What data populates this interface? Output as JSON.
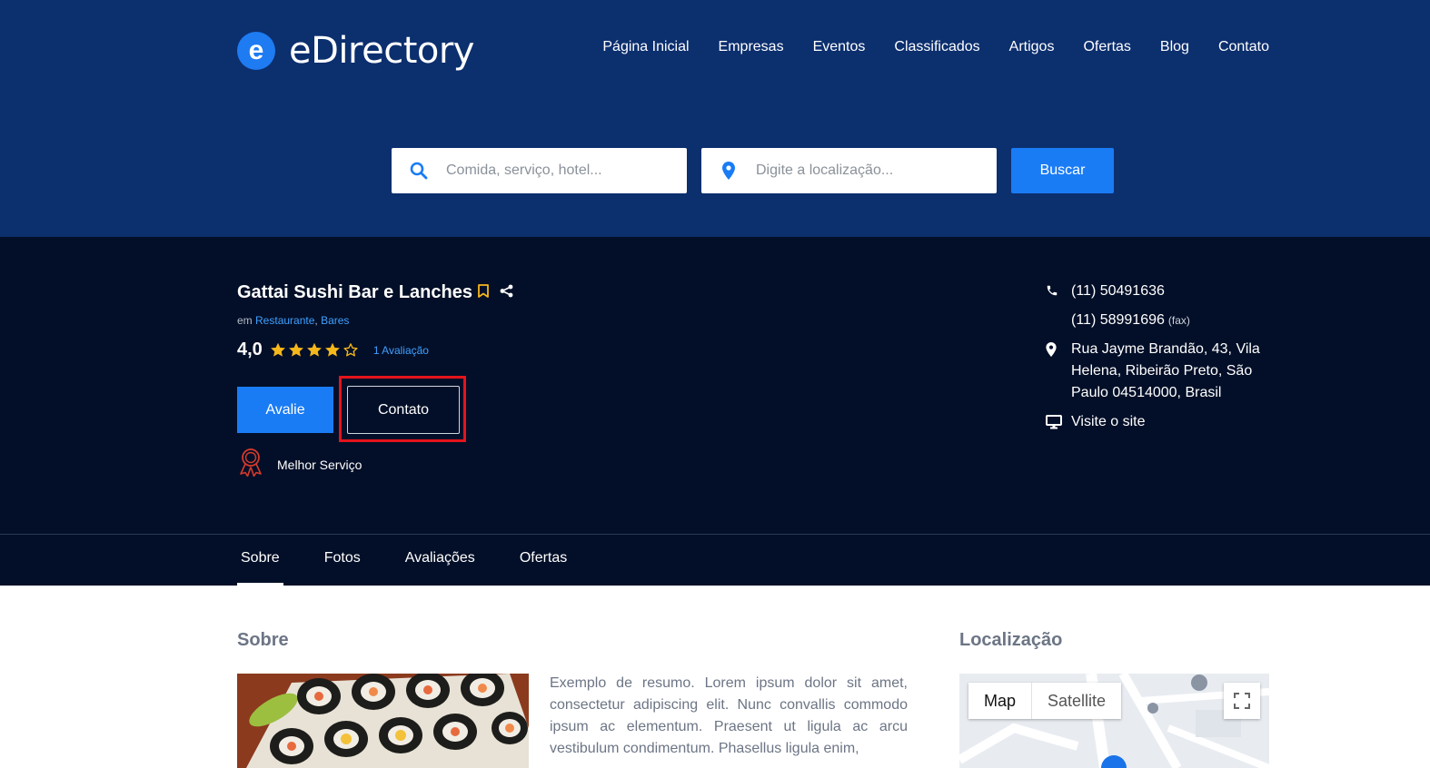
{
  "brand": {
    "name": "eDirectory",
    "mark": "e"
  },
  "nav": [
    "Página Inicial",
    "Empresas",
    "Eventos",
    "Classificados",
    "Artigos",
    "Ofertas",
    "Blog",
    "Contato"
  ],
  "search": {
    "what_placeholder": "Comida, serviço, hotel...",
    "where_placeholder": "Digite a localização...",
    "button": "Buscar"
  },
  "listing": {
    "title": "Gattai Sushi Bar e Lanches",
    "category_prefix": "em",
    "categories": [
      "Restaurante",
      "Bares"
    ],
    "category_sep": ",",
    "rating": "4,0",
    "rating_value": 4,
    "rating_max": 5,
    "reviews_link": "1 Avaliação",
    "review_button": "Avalie",
    "contact_button": "Contato",
    "badge": "Melhor Serviço"
  },
  "contact": {
    "phone": "(11) 50491636",
    "fax": "(11) 58991696",
    "fax_label": "(fax)",
    "address": "Rua Jayme Brandão, 43, Vila Helena, Ribeirão Preto, São Paulo 04514000, Brasil",
    "website": "Visite o site"
  },
  "tabs": [
    {
      "label": "Sobre",
      "active": true
    },
    {
      "label": "Fotos",
      "active": false
    },
    {
      "label": "Avaliações",
      "active": false
    },
    {
      "label": "Ofertas",
      "active": false
    }
  ],
  "about": {
    "title": "Sobre",
    "text": "Exemplo de resumo. Lorem ipsum dolor sit amet, consectetur adipiscing elit. Nunc convallis commodo ipsum ac elementum. Praesent ut ligula ac arcu vestibulum condimentum. Phasellus ligula enim,"
  },
  "location": {
    "title": "Localização",
    "map_button": "Map",
    "satellite_button": "Satellite"
  },
  "colors": {
    "header_bg": "#0c2f6e",
    "listing_bg": "#030f28",
    "accent": "#1a7cf5",
    "star": "#f6b71b",
    "highlight": "#e4141b"
  }
}
